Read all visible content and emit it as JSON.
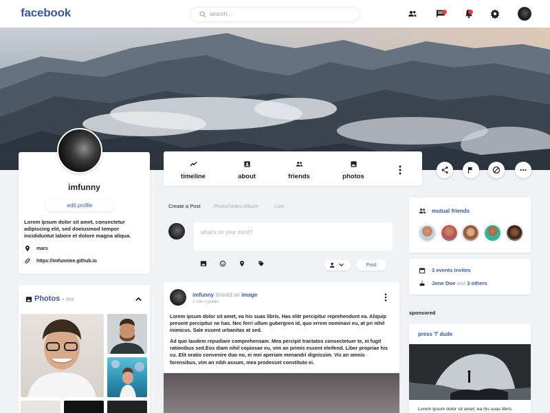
{
  "header": {
    "logo": "facebook",
    "search_placeholder": "search...",
    "icons": [
      "friends-icon",
      "messages-icon",
      "notifications-icon",
      "settings-icon"
    ],
    "notification_badge_color": "#e0404c"
  },
  "profile": {
    "username": "imfunny",
    "edit_label": "edit profile",
    "bio": "Lorem ipsum dolor sit amet, consectetur adipiscing elit, sed doeiusmod tempor incididuntut labore et dolore magna aliqua.",
    "location": "mars",
    "website": "https://imfunniee.github.io"
  },
  "tabs": [
    {
      "label": "timeline",
      "icon": "trending-icon"
    },
    {
      "label": "about",
      "icon": "contact-icon"
    },
    {
      "label": "friends",
      "icon": "people-icon"
    },
    {
      "label": "photos",
      "icon": "image-icon"
    }
  ],
  "composer": {
    "tabs": [
      "Create a Post",
      "Photo/Video Album",
      "Live"
    ],
    "placeholder": "what's on your mind?",
    "post_label": "Post"
  },
  "post": {
    "author": "imfunny",
    "action": "shared an",
    "object": "image",
    "time": "2 min",
    "separator": "•",
    "visibility": "public",
    "paragraph1": "Lorem ipsum dolor sit amet, ea his suas libris. Has elitr percipitur reprehendunt ea. Aliquip present percipitur ne has. Nec ferri ullum gubergren id, quo errem nominavi eu, at pri nihil inimicus. Sale essent urbanitas at sed.",
    "paragraph2": "Ad quo laudem repudiare comprehensam. Mea percipit tractatos consectetuer te, ei fugit rationibus sed.Eos diam nihil copiosae eu, vim an primis essent eleifend. Liber propriae his cu. Elit oratio convenire duo no, ei mei aperiam menandri dignissim. Vix an omnis forensibus, vim an nibh assum, mea prodesset constituto ei."
  },
  "photos": {
    "title": "Photos",
    "separator": "•",
    "count": "604"
  },
  "sidebar_right": {
    "mutual_friends_label": "mutual friends",
    "events_label": "3 events invites",
    "birthday_name": "Jone Doe",
    "birthday_and": "and",
    "birthday_others": "3 others",
    "sponsored_label": "sponsored",
    "ad_title": "press 'f' dude",
    "ad_text": "Lorem ipsum dolor sit amet, ea his suas libris."
  },
  "colors": {
    "brand": "#3b5998",
    "background": "#f0f2f5"
  }
}
